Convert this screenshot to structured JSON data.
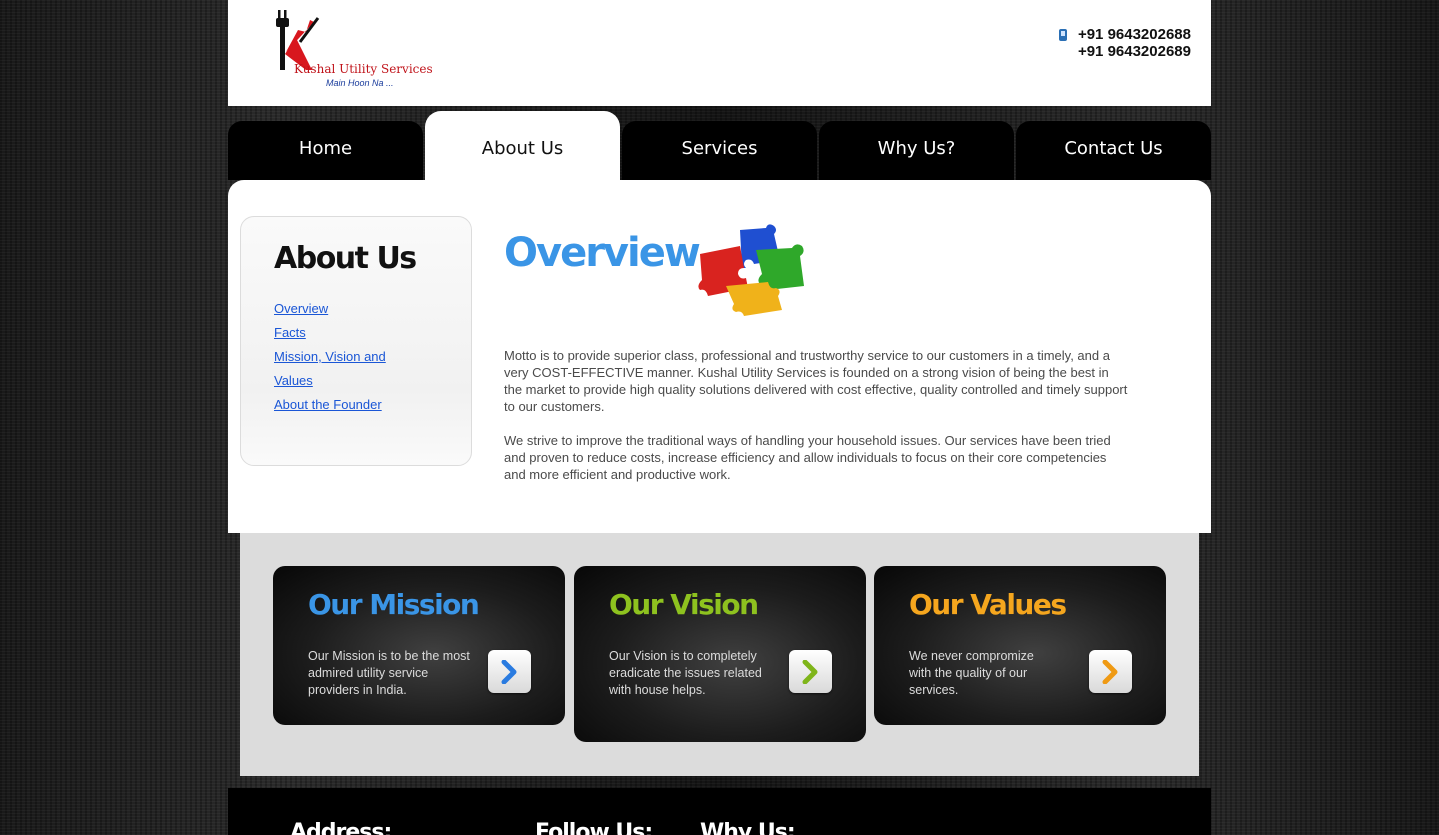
{
  "header": {
    "logo": {
      "name": "Kushal Utility Services",
      "tagline": "Main Hoon Na ..."
    },
    "phones": [
      "+91 9643202688",
      "+91 9643202689"
    ]
  },
  "nav": {
    "tabs": [
      {
        "label": "Home"
      },
      {
        "label": "About Us",
        "active": true
      },
      {
        "label": "Services"
      },
      {
        "label": "Why Us?"
      },
      {
        "label": "Contact Us"
      }
    ]
  },
  "sidebar": {
    "title": "About Us",
    "links": [
      {
        "label": "Overview"
      },
      {
        "label": "Facts"
      },
      {
        "label": "Mission, Vision and Values"
      },
      {
        "label": "About the Founder"
      }
    ]
  },
  "main": {
    "title": "Overview",
    "paragraphs": [
      "Motto is to provide superior class, professional and trustworthy service to our customers in a timely, and a very COST-EFFECTIVE manner. Kushal Utility Services is founded on a strong vision of being the best in the market to provide high quality solutions delivered with cost effective, quality controlled and timely support to our customers.",
      "We strive to improve the traditional ways of handling your household issues. Our services have been tried and proven to reduce costs, increase efficiency and allow individuals to focus on their core competencies and more efficient and productive work."
    ]
  },
  "cards": [
    {
      "title": "Our Mission",
      "text": "Our Mission is to be the most admired utility service providers in India.",
      "color": "#3a95e6"
    },
    {
      "title": "Our Vision",
      "text": "Our Vision is to completely eradicate the issues related with house helps.",
      "color": "#8ec21f"
    },
    {
      "title": "Our Values",
      "text": "We never compromize with the quality of our services.",
      "color": "#f5a61e"
    }
  ],
  "footer": {
    "address_heading": "Address:",
    "follow_heading": "Follow Us:",
    "why_heading": "Why Us:"
  },
  "colors": {
    "mission": "#3a95e6",
    "vision": "#8ec21f",
    "values": "#f5a61e",
    "link": "#1a56d6"
  },
  "icons": [
    "plug-logo-icon",
    "mobile-phone-icon",
    "puzzle-icon",
    "chevron-right-icon"
  ]
}
